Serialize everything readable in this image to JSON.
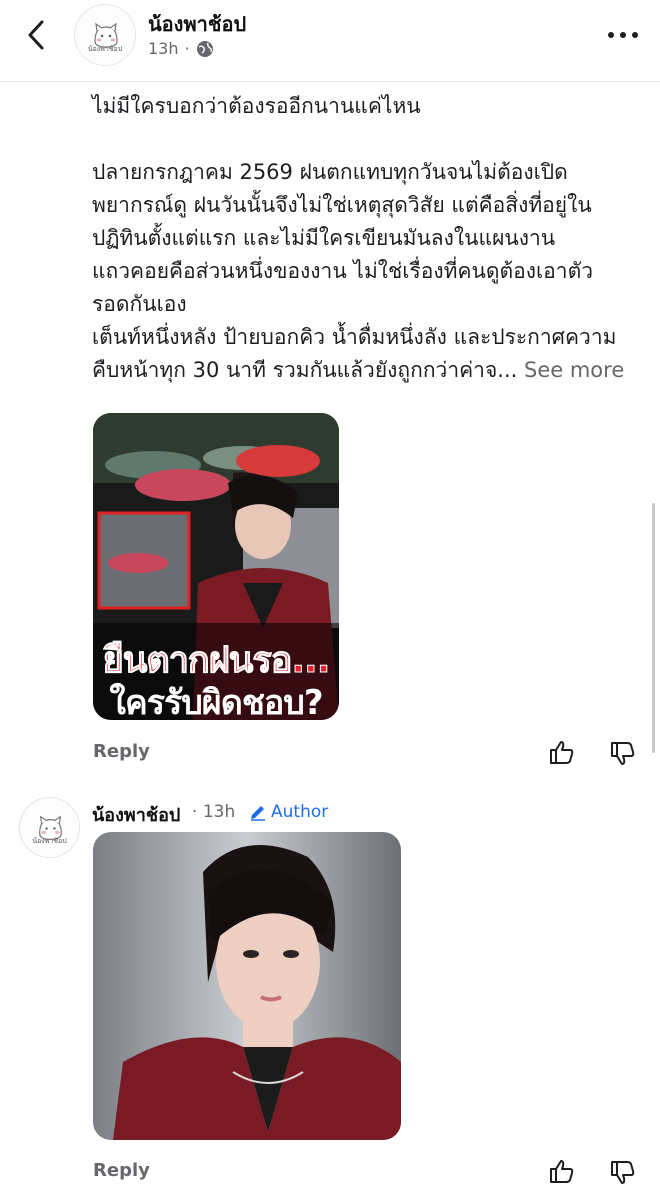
{
  "header": {
    "page_name": "น้องพาช้อป",
    "time": "13h",
    "separator": "·",
    "avatar_caption": "น้องพาช้อป",
    "icons": {
      "back": "chevron-left-icon",
      "privacy": "globe-icon",
      "menu": "more-dots-icon"
    }
  },
  "post": {
    "paragraphs": [
      "ไม่มีใครบอกว่าต้องรออีกนานแค่ไหน",
      "ปลายกรกฎาคม 2569 ฝนตกแทบทุกวันจนไม่ต้องเปิด\nพยากรณ์ดู ฝนวันนั้นจึงไม่ใช่เหตุสุดวิสัย แต่คือสิ่งที่อยู่ใน\nปฏิทินตั้งแต่แรก และไม่มีใครเขียนมันลงในแผนงาน",
      "แถวคอยคือส่วนหนึ่งของงาน ไม่ใช่เรื่องที่คนดูต้องเอาตัว\nรอดกันเอง\nเต็นท์หนึ่งหลัง ป้ายบอกคิว น้ำดื่มหนึ่งลัง และประกาศความ\nคืบหน้าทุก 30 นาที รวมกันแล้วยังถูกกว่าค่าจ..."
    ],
    "see_more": "See more",
    "image_overlay": {
      "line1": "ยืนตากฝนรอ...",
      "line2": "ใครรับผิดชอบ?"
    },
    "reply_label": "Reply"
  },
  "comment": {
    "author": "น้องพาช้อป",
    "separator": "·",
    "time": "13h",
    "badge": "Author",
    "avatar_caption": "น้องพาช้อป",
    "reply_label": "Reply"
  },
  "colors": {
    "accent": "#1f6feb",
    "muted": "#65676b",
    "text": "#1c1e21",
    "overlay_red": "#e8202a"
  }
}
